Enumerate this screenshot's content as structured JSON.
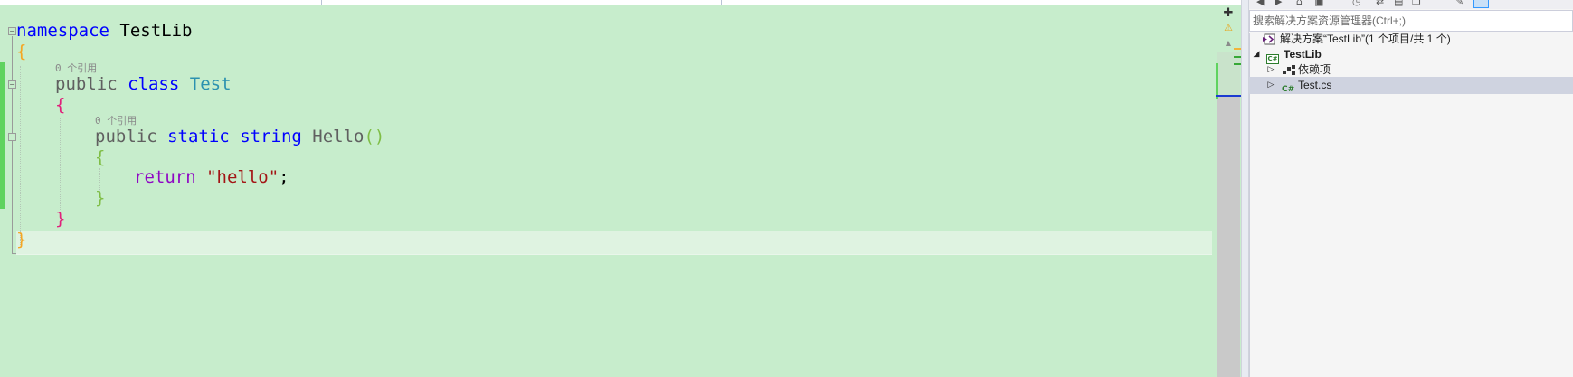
{
  "editor": {
    "namespace_kw": "namespace",
    "namespace_name": "TestLib",
    "open_brace": "{",
    "close_brace": "}",
    "class_lens": "0 个引用",
    "class_modifier": "public",
    "class_kw": "class",
    "class_name": "Test",
    "method_lens": "0 个引用",
    "method_modifier": "public",
    "method_static": "static",
    "method_type": "string",
    "method_name": "Hello",
    "method_parens": "()",
    "return_kw": "return",
    "return_value": "\"hello\"",
    "semicolon": ";"
  },
  "explorer": {
    "search_placeholder": "搜索解决方案资源管理器(Ctrl+;)",
    "solution_label": "解决方案“TestLib”(1 个项目/共 1 个)",
    "project_label": "TestLib",
    "dependencies_label": "依赖项",
    "file_label": "Test.cs",
    "selected_item": "Test.cs",
    "icons": [
      "back-icon",
      "forward-icon",
      "home-icon",
      "sync-icon",
      "history-icon",
      "switch-view-icon",
      "collapse-icon",
      "copy-icon",
      "properties-icon",
      "preview-icon"
    ]
  },
  "scrollbar": {
    "split_glyph": "✚",
    "warning_glyph": "⚠",
    "up_glyph": "▲"
  },
  "colors": {
    "editor_bg": "#c7edcc",
    "keyword": "#0000ff",
    "control_keyword": "#8f08c4",
    "class": "#2b91af",
    "string": "#a31515",
    "change_bar": "#5fd35f",
    "selection": "#cfd3e0"
  }
}
